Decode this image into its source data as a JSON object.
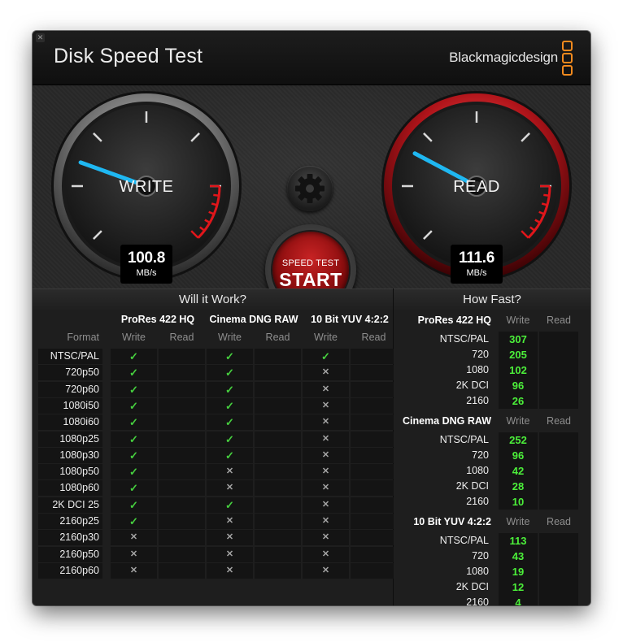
{
  "window": {
    "title": "Disk Speed Test",
    "brand": "Blackmagicdesign",
    "close_glyph": "✕"
  },
  "write_gauge": {
    "label": "WRITE",
    "value": "100.8",
    "unit": "MB/s",
    "dial_fraction": 0.24
  },
  "read_gauge": {
    "label": "READ",
    "value": "111.6",
    "unit": "MB/s",
    "dial_fraction": 0.27
  },
  "start_button": {
    "small_label": "SPEED TEST",
    "big_label": "START"
  },
  "settings_button": {
    "icon": "gear-icon"
  },
  "will_it_work": {
    "title": "Will it Work?",
    "format_header": "Format",
    "write_header": "Write",
    "read_header": "Read",
    "codecs": [
      "ProRes 422 HQ",
      "Cinema DNG RAW",
      "10 Bit YUV 4:2:2"
    ],
    "rows": [
      {
        "format": "NTSC/PAL",
        "marks": [
          "✓",
          "✓",
          "✓"
        ]
      },
      {
        "format": "720p50",
        "marks": [
          "✓",
          "✓",
          "✕"
        ]
      },
      {
        "format": "720p60",
        "marks": [
          "✓",
          "✓",
          "✕"
        ]
      },
      {
        "format": "1080i50",
        "marks": [
          "✓",
          "✓",
          "✕"
        ]
      },
      {
        "format": "1080i60",
        "marks": [
          "✓",
          "✓",
          "✕"
        ]
      },
      {
        "format": "1080p25",
        "marks": [
          "✓",
          "✓",
          "✕"
        ]
      },
      {
        "format": "1080p30",
        "marks": [
          "✓",
          "✓",
          "✕"
        ]
      },
      {
        "format": "1080p50",
        "marks": [
          "✓",
          "✕",
          "✕"
        ]
      },
      {
        "format": "1080p60",
        "marks": [
          "✓",
          "✕",
          "✕"
        ]
      },
      {
        "format": "2K DCI 25",
        "marks": [
          "✓",
          "✓",
          "✕"
        ]
      },
      {
        "format": "2160p25",
        "marks": [
          "✓",
          "✕",
          "✕"
        ]
      },
      {
        "format": "2160p30",
        "marks": [
          "✕",
          "✕",
          "✕"
        ]
      },
      {
        "format": "2160p50",
        "marks": [
          "✕",
          "✕",
          "✕"
        ]
      },
      {
        "format": "2160p60",
        "marks": [
          "✕",
          "✕",
          "✕"
        ]
      }
    ]
  },
  "how_fast": {
    "title": "How Fast?",
    "write_header": "Write",
    "read_header": "Read",
    "groups": [
      {
        "codec": "ProRes 422 HQ",
        "rows": [
          {
            "format": "NTSC/PAL",
            "write": "307"
          },
          {
            "format": "720",
            "write": "205"
          },
          {
            "format": "1080",
            "write": "102"
          },
          {
            "format": "2K DCI",
            "write": "96"
          },
          {
            "format": "2160",
            "write": "26"
          }
        ]
      },
      {
        "codec": "Cinema DNG RAW",
        "rows": [
          {
            "format": "NTSC/PAL",
            "write": "252"
          },
          {
            "format": "720",
            "write": "96"
          },
          {
            "format": "1080",
            "write": "42"
          },
          {
            "format": "2K DCI",
            "write": "28"
          },
          {
            "format": "2160",
            "write": "10"
          }
        ]
      },
      {
        "codec": "10 Bit YUV 4:2:2",
        "rows": [
          {
            "format": "NTSC/PAL",
            "write": "113"
          },
          {
            "format": "720",
            "write": "43"
          },
          {
            "format": "1080",
            "write": "19"
          },
          {
            "format": "2K DCI",
            "write": "12"
          },
          {
            "format": "2160",
            "write": "4"
          }
        ]
      }
    ]
  },
  "colors": {
    "check": "#46d03f",
    "number": "#4cf03a",
    "needle": "#1fb8f2",
    "accent_red": "#c21d1e",
    "brand_orange": "#f28a1e"
  }
}
